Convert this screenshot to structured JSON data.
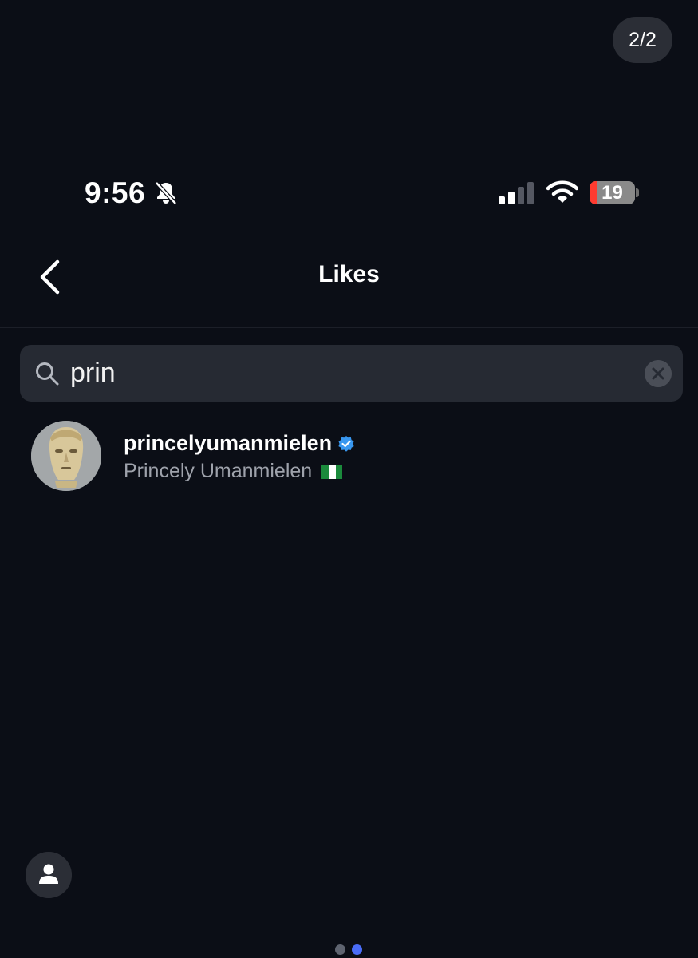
{
  "viewer": {
    "page_counter": "2/2",
    "pager_dots": 2,
    "active_dot": 2
  },
  "status_bar": {
    "time": "9:56",
    "battery_level": "19",
    "icons": [
      "bell-slash-icon",
      "signal-icon",
      "wifi-icon",
      "battery-icon"
    ]
  },
  "header": {
    "title": "Likes",
    "back_icon": "chevron-left-icon"
  },
  "search": {
    "value": "prin",
    "icon": "search-icon",
    "clear_icon": "clear-x-icon"
  },
  "results": [
    {
      "username": "princelyumanmielen",
      "full_name": "Princely Umanmielen",
      "verified": true,
      "flag": "Nigeria flag"
    }
  ],
  "colors": {
    "background": "#0b0e16",
    "search_bg": "#262a33",
    "verified": "#3897f0",
    "battery_low": "#ff3b30",
    "active_dot": "#4a6cf7"
  }
}
